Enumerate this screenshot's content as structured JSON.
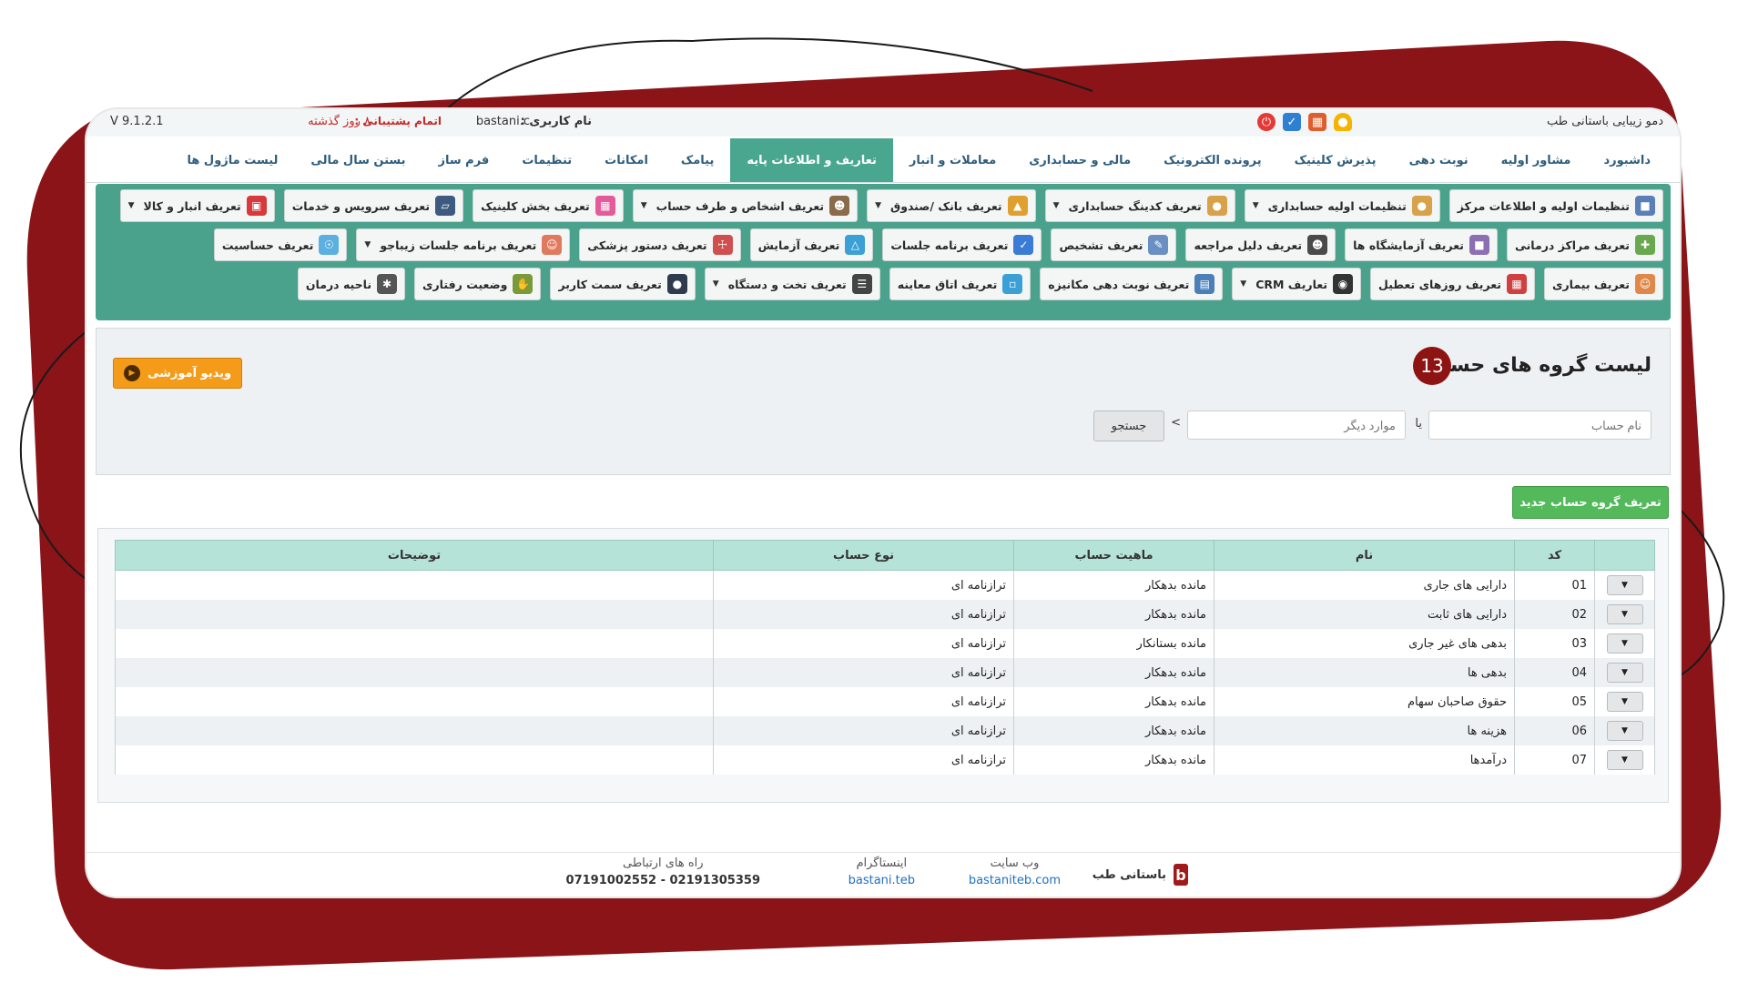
{
  "theme": {
    "frame": "#8a1418",
    "accent": "#4aa28c",
    "active_tab": "#49a68f"
  },
  "topbar": {
    "company": "دمو زیبایی باستانی طب",
    "icons": [
      "bell-icon",
      "calendar-icon",
      "check-calendar-icon",
      "power-icon"
    ],
    "user_label": "نام کاربری :",
    "user_value": "bastani.c",
    "support_label": "اتمام پشتیبانی :",
    "support_value": "۸ روز گذشته",
    "version": "V 9.1.2.1"
  },
  "mainmenu": {
    "items": [
      {
        "label": "داشبورد",
        "active": false
      },
      {
        "label": "مشاور اولیه",
        "active": false
      },
      {
        "label": "نوبت دهی",
        "active": false
      },
      {
        "label": "پذیرش کلینیک",
        "active": false
      },
      {
        "label": "پرونده الکترونیک",
        "active": false
      },
      {
        "label": "مالی و حسابداری",
        "active": false
      },
      {
        "label": "معاملات و انبار",
        "active": false
      },
      {
        "label": "تعاریف و اطلاعات پایه",
        "active": true
      },
      {
        "label": "پیامک",
        "active": false
      },
      {
        "label": "امکانات",
        "active": false
      },
      {
        "label": "تنظیمات",
        "active": false
      },
      {
        "label": "فرم ساز",
        "active": false
      },
      {
        "label": "بستن سال مالی",
        "active": false
      },
      {
        "label": "لیست ماژول ها",
        "active": false
      }
    ]
  },
  "submenu": {
    "row1": [
      {
        "label": "تنظیمات اولیه و اطلاعات مرکز",
        "icon": "building-icon",
        "color": "#5a7fb8",
        "caret": false
      },
      {
        "label": "تنظیمات اولیه حسابداری",
        "icon": "hand-coins-icon",
        "color": "#d8a24a",
        "caret": true
      },
      {
        "label": "تعریف کدینگ حسابداری",
        "icon": "hand-coins-icon",
        "color": "#d8a24a",
        "caret": true
      },
      {
        "label": "تعریف بانک /صندوق",
        "icon": "bank-icon",
        "color": "#e0a030",
        "caret": true
      },
      {
        "label": "تعریف اشخاص و طرف حساب",
        "icon": "person-card-icon",
        "color": "#8a6b4a",
        "caret": true
      },
      {
        "label": "تعریف بخش کلینیک",
        "icon": "grid-icon",
        "color": "#e55a9a",
        "caret": false
      },
      {
        "label": "تعریف سرویس و خدمات",
        "icon": "monitor-pulse-icon",
        "color": "#3d5a80",
        "caret": false
      },
      {
        "label": "تعریف انبار و کالا",
        "icon": "boxes-icon",
        "color": "#d63a3a",
        "caret": true
      }
    ],
    "row2": [
      {
        "label": "تعریف مراکز درمانی",
        "icon": "hospital-icon",
        "color": "#6aa84f",
        "caret": false
      },
      {
        "label": "تعریف آزمایشگاه ها",
        "icon": "lab-building-icon",
        "color": "#8c6fb3",
        "caret": false
      },
      {
        "label": "تعریف دلیل مراجعه",
        "icon": "doctor-icon",
        "color": "#4a4a4a",
        "caret": false
      },
      {
        "label": "تعریف تشخیص",
        "icon": "clipboard-icon",
        "color": "#6a8fc2",
        "caret": false
      },
      {
        "label": "تعریف برنامه جلسات",
        "icon": "schedule-icon",
        "color": "#3a7bd5",
        "caret": false
      },
      {
        "label": "تعریف آزمایش",
        "icon": "flask-icon",
        "color": "#3aa0d5",
        "caret": false
      },
      {
        "label": "تعریف دستور پزشکی",
        "icon": "prescription-icon",
        "color": "#d05050",
        "caret": false
      },
      {
        "label": "تعریف برنامه جلسات زیباجو",
        "icon": "session-people-icon",
        "color": "#e07a5f",
        "caret": true
      },
      {
        "label": "تعریف حساسیت",
        "icon": "allergy-icon",
        "color": "#5bb0e0",
        "caret": false
      }
    ],
    "row3": [
      {
        "label": "تعریف بیماری",
        "icon": "patient-icon",
        "color": "#e0884a",
        "caret": false
      },
      {
        "label": "تعریف روزهای تعطیل",
        "icon": "calendar-holiday-icon",
        "color": "#d04040",
        "caret": false
      },
      {
        "label": "تعاریف CRM",
        "icon": "crm-icon",
        "color": "#333333",
        "caret": true
      },
      {
        "label": "تعریف نوبت دهی مکانیزه",
        "icon": "computer-schedule-icon",
        "color": "#4a7fb8",
        "caret": false
      },
      {
        "label": "تعریف اتاق معاینه",
        "icon": "exam-room-icon",
        "color": "#3aa0d5",
        "caret": false
      },
      {
        "label": "تعریف تخت و دستگاه",
        "icon": "device-list-icon",
        "color": "#444444",
        "caret": true
      },
      {
        "label": "تعریف سمت کاربر",
        "icon": "user-role-icon",
        "color": "#2e3b4e",
        "caret": false
      },
      {
        "label": "وضعیت رفتاری",
        "icon": "behavior-hand-icon",
        "color": "#7a9a3a",
        "caret": false
      },
      {
        "label": "ناحیه درمان",
        "icon": "body-area-icon",
        "color": "#555555",
        "caret": false
      }
    ]
  },
  "page": {
    "title": "لیست گروه های حساب",
    "count": "13",
    "video_label": "ویدیو آموزشی",
    "search": {
      "name_placeholder": "نام حساب",
      "sep_ya": "یا",
      "other_placeholder": "موارد دیگر",
      "sep_gt": ">",
      "button": "جستجو"
    },
    "new_button": "تعریف گروه حساب جدید"
  },
  "table": {
    "headers": [
      "کد",
      "نام",
      "ماهیت حساب",
      "نوع حساب",
      "توضیحات"
    ],
    "rows": [
      {
        "code": "01",
        "name": "دارایی های جاری",
        "nature": "مانده بدهکار",
        "type": "ترازنامه ای",
        "desc": ""
      },
      {
        "code": "02",
        "name": "دارایی های ثابت",
        "nature": "مانده بدهکار",
        "type": "ترازنامه ای",
        "desc": ""
      },
      {
        "code": "03",
        "name": "بدهی های غیر جاری",
        "nature": "مانده بستانکار",
        "type": "ترازنامه ای",
        "desc": ""
      },
      {
        "code": "04",
        "name": "بدهی ها",
        "nature": "مانده بدهکار",
        "type": "ترازنامه ای",
        "desc": ""
      },
      {
        "code": "05",
        "name": "حقوق صاحبان سهام",
        "nature": "مانده بدهکار",
        "type": "ترازنامه ای",
        "desc": ""
      },
      {
        "code": "06",
        "name": "هزینه ها",
        "nature": "مانده بدهکار",
        "type": "ترازنامه ای",
        "desc": ""
      },
      {
        "code": "07",
        "name": "درآمدها",
        "nature": "مانده بدهکار",
        "type": "ترازنامه ای",
        "desc": ""
      }
    ]
  },
  "footer": {
    "brand": "باستانی طب",
    "website_label": "وب سایت",
    "website_value": "bastaniteb.com",
    "instagram_label": "اینستاگرام",
    "instagram_value": "bastani.teb",
    "contact_label": "راه های ارتباطی",
    "contact_value": "07191002552 - 02191305359"
  }
}
